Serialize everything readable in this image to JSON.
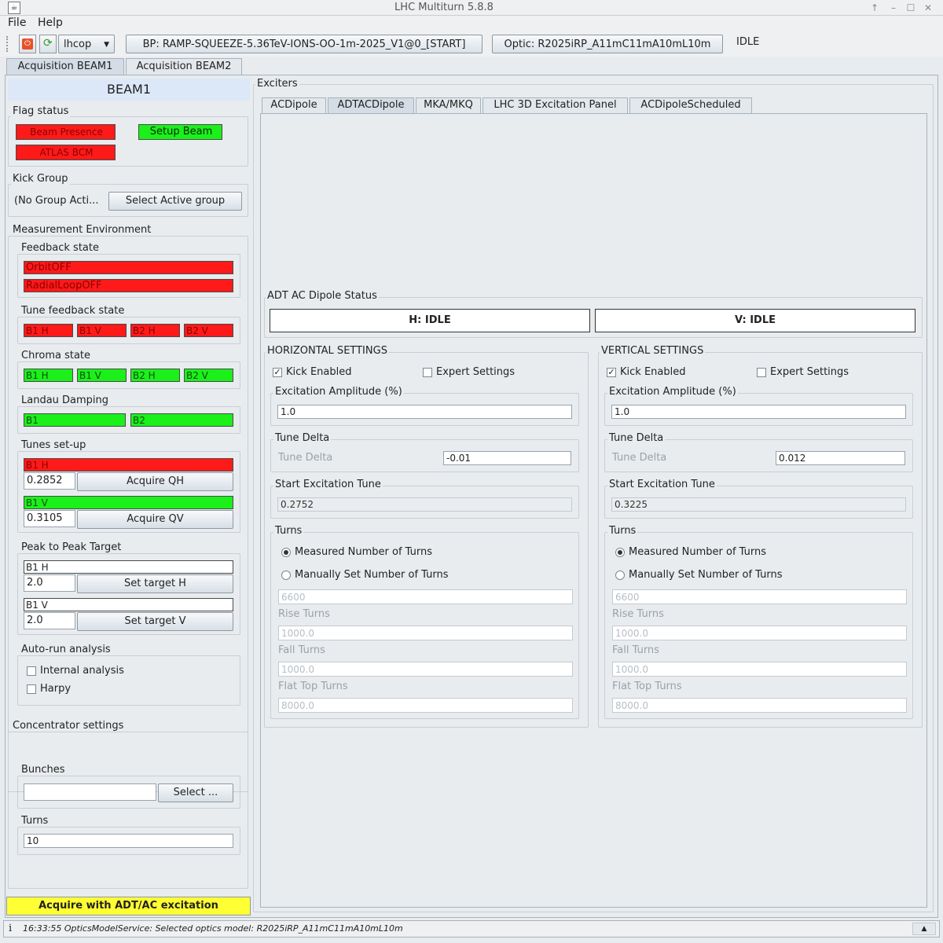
{
  "window": {
    "title": "LHC Multiturn 5.8.8",
    "app_icon": "java-icon"
  },
  "menu": {
    "file": "File",
    "help": "Help"
  },
  "toolbar": {
    "user": "lhcop",
    "beam_process": "BP: RAMP-SQUEEZE-5.36TeV-IONS-OO-1m-2025_V1@0_[START]",
    "optic": "Optic: R2025iRP_A11mC11mA10mL10m",
    "state": "IDLE"
  },
  "main_tabs": [
    "Acquisition BEAM1",
    "Acquisition BEAM2"
  ],
  "left": {
    "beam_title": "BEAM1",
    "flag_status": {
      "legend": "Flag status",
      "beam_presence": "Beam Presence",
      "setup_beam": "Setup Beam",
      "atlas_bcm": "ATLAS BCM"
    },
    "kick_group": {
      "legend": "Kick Group",
      "value": "(No Group Acti...",
      "button": "Select Active group"
    },
    "measurement_env": {
      "legend": "Measurement Environment",
      "feedback": {
        "legend": "Feedback state",
        "orbit": "OrbitOFF",
        "radial": "RadialLoopOFF"
      },
      "tune_feedback": {
        "legend": "Tune feedback state",
        "items": [
          "B1 H",
          "B1 V",
          "B2 H",
          "B2 V"
        ]
      },
      "chroma": {
        "legend": "Chroma state",
        "items": [
          "B1 H",
          "B1 V",
          "B2 H",
          "B2 V"
        ]
      },
      "landau": {
        "legend": "Landau Damping",
        "b1": "B1",
        "b2": "B2"
      },
      "tunes": {
        "legend": "Tunes set-up",
        "h_label": "B1 H",
        "h_value": "0.2852",
        "h_button": "Acquire QH",
        "v_label": "B1 V",
        "v_value": "0.3105",
        "v_button": "Acquire QV"
      },
      "p2p": {
        "legend": "Peak to Peak Target",
        "h_label": "B1 H",
        "h_value": "2.0",
        "h_button": "Set target H",
        "v_label": "B1 V",
        "v_value": "2.0",
        "v_button": "Set target V"
      },
      "autorun": {
        "legend": "Auto-run analysis",
        "internal": "Internal analysis",
        "harpy": "Harpy"
      }
    },
    "concentrator": {
      "legend": "Concentrator settings",
      "bunches_legend": "Bunches",
      "bunches_value": "",
      "select_button": "Select ...",
      "turns_legend": "Turns",
      "turns_value": "10"
    },
    "acquire_button": "Acquire with ADT/AC excitation"
  },
  "exciters": {
    "legend": "Exciters",
    "tabs": [
      "ACDipole",
      "ADTACDipole",
      "MKA/MKQ",
      "LHC 3D Excitation Panel",
      "ACDipoleScheduled"
    ],
    "status": {
      "legend": "ADT AC Dipole Status",
      "h": "H: IDLE",
      "v": "V: IDLE"
    },
    "horizontal": {
      "legend": "HORIZONTAL SETTINGS",
      "kick": "Kick Enabled",
      "kick_checked": true,
      "expert": "Expert Settings",
      "amp_legend": "Excitation Amplitude (%)",
      "amp_value": "1.0",
      "tune_delta_legend": "Tune Delta",
      "tune_delta_label": "Tune Delta",
      "tune_delta_value": "-0.01",
      "start_tune_legend": "Start Excitation Tune",
      "start_tune_value": "0.2752",
      "turns_legend": "Turns",
      "measured": "Measured Number of Turns",
      "manual": "Manually Set Number of Turns",
      "manual_value": "6600",
      "rise_label": "Rise Turns",
      "rise_value": "1000.0",
      "fall_label": "Fall Turns",
      "fall_value": "1000.0",
      "flat_label": "Flat Top Turns",
      "flat_value": "8000.0"
    },
    "vertical": {
      "legend": "VERTICAL SETTINGS",
      "kick": "Kick Enabled",
      "kick_checked": true,
      "expert": "Expert Settings",
      "amp_legend": "Excitation Amplitude (%)",
      "amp_value": "1.0",
      "tune_delta_legend": "Tune Delta",
      "tune_delta_label": "Tune Delta",
      "tune_delta_value": "0.012",
      "start_tune_legend": "Start Excitation Tune",
      "start_tune_value": "0.3225",
      "turns_legend": "Turns",
      "measured": "Measured Number of Turns",
      "manual": "Manually Set Number of Turns",
      "manual_value": "6600",
      "rise_label": "Rise Turns",
      "rise_value": "1000.0",
      "fall_label": "Fall Turns",
      "fall_value": "1000.0",
      "flat_label": "Flat Top Turns",
      "flat_value": "8000.0"
    }
  },
  "statusbar": {
    "message": "16:33:55 OpticsModelService: Selected optics model: R2025iRP_A11mC11mA10mL10m"
  },
  "colors": {
    "red": "#ff1a1a",
    "green": "#1bf01b",
    "yellow": "#ffff33",
    "beam_header": "#dce8f7"
  }
}
